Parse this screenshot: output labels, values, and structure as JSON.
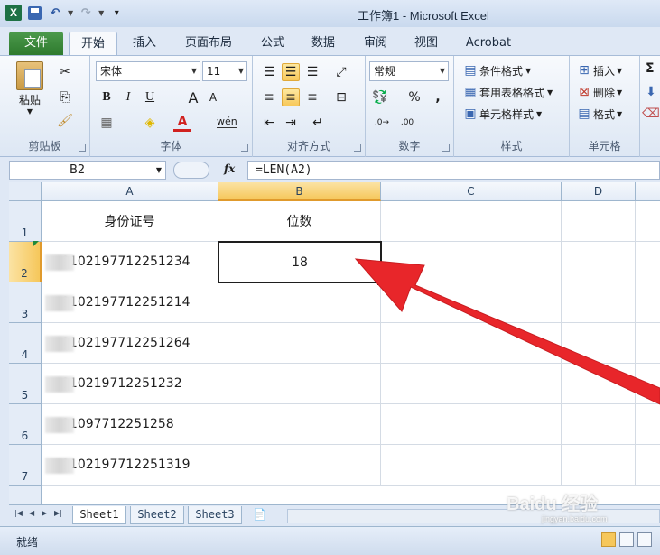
{
  "window": {
    "title": "工作簿1 - Microsoft Excel"
  },
  "tabs": [
    {
      "label": "文件"
    },
    {
      "label": "开始"
    },
    {
      "label": "插入"
    },
    {
      "label": "页面布局"
    },
    {
      "label": "公式"
    },
    {
      "label": "数据"
    },
    {
      "label": "审阅"
    },
    {
      "label": "视图"
    },
    {
      "label": "Acrobat"
    }
  ],
  "ribbon": {
    "clipboard": {
      "label": "剪贴板",
      "paste": "粘贴"
    },
    "font": {
      "label": "字体",
      "font_name": "宋体",
      "font_size": "11",
      "bold": "B",
      "italic": "I",
      "underline": "U",
      "grow": "A",
      "shrink": "A",
      "wen": "wén"
    },
    "alignment": {
      "label": "对齐方式"
    },
    "number": {
      "label": "数字",
      "format": "常规",
      "percent": "%",
      "comma": ","
    },
    "styles": {
      "label": "样式",
      "conditional": "条件格式",
      "table": "套用表格格式",
      "cell": "单元格样式"
    },
    "cells": {
      "label": "单元格",
      "insert": "插入",
      "delete": "删除",
      "format": "格式"
    },
    "editing": {
      "sigma": "Σ"
    }
  },
  "formula_bar": {
    "name_box": "B2",
    "fx": "fx",
    "formula": "=LEN(A2)"
  },
  "columns": [
    "A",
    "B",
    "C",
    "D"
  ],
  "rows": [
    {
      "num": "1",
      "a": "身份证号",
      "b": "位数"
    },
    {
      "num": "2",
      "a": "0102197712251234",
      "b": "18"
    },
    {
      "num": "3",
      "a": "0102197712251214",
      "b": ""
    },
    {
      "num": "4",
      "a": "0102197712251264",
      "b": ""
    },
    {
      "num": "5",
      "a": "010219712251232",
      "b": ""
    },
    {
      "num": "6",
      "a": "01097712251258",
      "b": ""
    },
    {
      "num": "7",
      "a": "0102197712251319",
      "b": ""
    }
  ],
  "sheets": [
    {
      "label": "Sheet1"
    },
    {
      "label": "Sheet2"
    },
    {
      "label": "Sheet3"
    }
  ],
  "status": {
    "text": "就绪"
  },
  "watermark": {
    "text": "Baidu 经验",
    "sub": "jingyan.baidu.com"
  },
  "colors": {
    "accent_arrow": "#e8262a",
    "file_tab": "#2e7a2e",
    "selection": "#f6c75b"
  }
}
